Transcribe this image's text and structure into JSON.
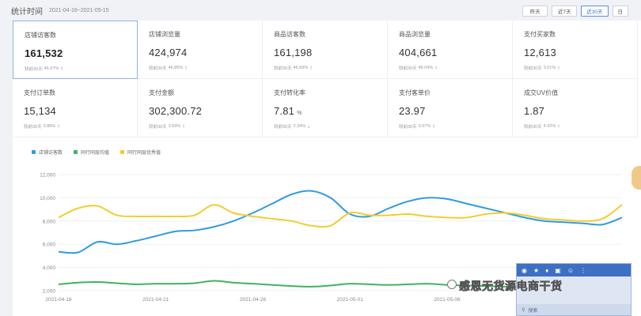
{
  "header": {
    "label": "统计时间",
    "range": "2021-04-16~2021-05-15",
    "buttons": [
      "昨天",
      "近7天",
      "近30天",
      "日"
    ],
    "active_index": 2
  },
  "metrics": [
    {
      "title": "店铺访客数",
      "value": "161,532",
      "compare_label": "较前30天",
      "pct": "46.67%",
      "dir": "up",
      "selected": true
    },
    {
      "title": "店铺浏览量",
      "value": "424,974",
      "compare_label": "较前30天",
      "pct": "46.85%",
      "dir": "up"
    },
    {
      "title": "商品访客数",
      "value": "161,198",
      "compare_label": "较前30天",
      "pct": "46.66%",
      "dir": "up"
    },
    {
      "title": "商品浏览量",
      "value": "404,661",
      "compare_label": "较前30天",
      "pct": "48.04%",
      "dir": "up"
    },
    {
      "title": "支付买家数",
      "value": "12,613",
      "compare_label": "较前30天",
      "pct": "3.61%",
      "dir": "up"
    },
    {
      "title": "支付订单数",
      "value": "15,134",
      "compare_label": "较前30天",
      "pct": "3.88%",
      "dir": "up"
    },
    {
      "title": "支付金额",
      "value": "302,300.72",
      "compare_label": "较前30天",
      "pct": "3.69%",
      "dir": "up"
    },
    {
      "title": "支付转化率",
      "value": "7.81",
      "unit": "%",
      "compare_label": "较前30天",
      "pct": "2.34%",
      "dir": "down"
    },
    {
      "title": "支付客单价",
      "value": "23.97",
      "compare_label": "较前30天",
      "pct": "0.07%",
      "dir": "up"
    },
    {
      "title": "成交UV价值",
      "value": "1.87",
      "compare_label": "较前30天",
      "pct": "4.42%",
      "dir": "up"
    }
  ],
  "chart_data": {
    "type": "line",
    "ylim": [
      2000,
      12000
    ],
    "yticks": [
      "2,000",
      "4,000",
      "6,000",
      "8,000",
      "10,000",
      "12,000"
    ],
    "xtick_labels": [
      "2021-04-16",
      "2021-04-21",
      "2021-04-26",
      "2021-05-01",
      "2021-05-06"
    ],
    "x": [
      "2021-04-16",
      "2021-04-17",
      "2021-04-18",
      "2021-04-19",
      "2021-04-20",
      "2021-04-21",
      "2021-04-22",
      "2021-04-23",
      "2021-04-24",
      "2021-04-25",
      "2021-04-26",
      "2021-04-27",
      "2021-04-28",
      "2021-04-29",
      "2021-04-30",
      "2021-05-01",
      "2021-05-02",
      "2021-05-03",
      "2021-05-04",
      "2021-05-05",
      "2021-05-06",
      "2021-05-07",
      "2021-05-08",
      "2021-05-09",
      "2021-05-10",
      "2021-05-11",
      "2021-05-12",
      "2021-05-13",
      "2021-05-14",
      "2021-05-15"
    ],
    "series": [
      {
        "name": "店铺访客数",
        "color": "#2f9be3",
        "values": [
          5350,
          5300,
          6200,
          6000,
          6300,
          6700,
          7100,
          7200,
          7500,
          8000,
          8700,
          9500,
          10300,
          10600,
          10000,
          8600,
          8400,
          9100,
          9700,
          10000,
          9900,
          9500,
          9100,
          8700,
          8300,
          8000,
          7900,
          7800,
          7700,
          8300
        ]
      },
      {
        "name": "同行同层均值",
        "color": "#41b35b",
        "values": [
          2550,
          2700,
          2750,
          2650,
          2550,
          2600,
          2600,
          2650,
          2850,
          2700,
          2600,
          2500,
          2400,
          2350,
          2450,
          2600,
          2550,
          2500,
          2550,
          2600,
          2500,
          2450,
          2400,
          2350,
          2300,
          2350,
          2400,
          2450,
          2400,
          2450
        ]
      },
      {
        "name": "同行同层优秀值",
        "color": "#f2cd2e",
        "values": [
          8300,
          9100,
          9300,
          8500,
          8400,
          8400,
          8400,
          8500,
          9400,
          8700,
          8400,
          8200,
          8000,
          7600,
          7600,
          8700,
          8500,
          8500,
          8600,
          8400,
          8300,
          8300,
          8600,
          8700,
          8500,
          8200,
          8100,
          8000,
          8200,
          9400
        ]
      }
    ]
  },
  "widget": {
    "search_placeholder": "搜索"
  },
  "watermark": "感恩无货源电商干货"
}
